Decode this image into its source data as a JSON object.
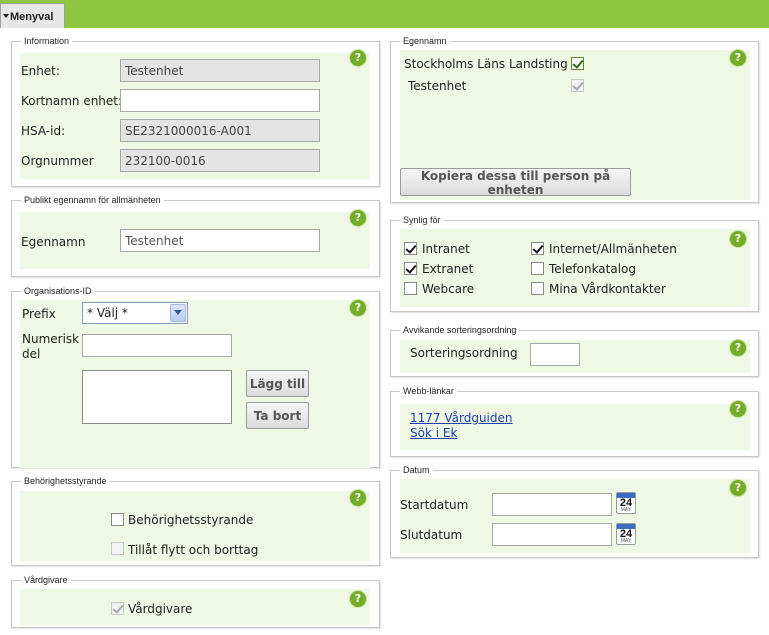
{
  "menu": {
    "label": "Menyval"
  },
  "information": {
    "legend": "Information",
    "enhet_label": "Enhet:",
    "enhet_value": "Testenhet",
    "kortnamn_label": "Kortnamn enhet:",
    "kortnamn_value": "",
    "hsa_label": "HSA-id:",
    "hsa_value": "SE2321000016-A001",
    "orgnummer_label": "Orgnummer",
    "orgnummer_value": "232100-0016"
  },
  "publikt": {
    "legend": "Publikt egennamn för allmänheten",
    "egennamn_label": "Egennamn",
    "egennamn_value": "Testenhet"
  },
  "organisations_id": {
    "legend": "Organisations-ID",
    "prefix_label": "Prefix",
    "prefix_selected": "* Välj *",
    "numerisk_label_1": "Numerisk",
    "numerisk_label_2": "del",
    "numerisk_value": "",
    "add_button": "Lägg till",
    "remove_button": "Ta bort"
  },
  "behorighet": {
    "legend": "Behörighetsstyrande",
    "behorighet_label": "Behörighetsstyrande",
    "behorighet_checked": false,
    "flytt_label": "Tillåt flytt och borttag",
    "flytt_checked": false
  },
  "vardgivare": {
    "legend": "Vårdgivare",
    "vardgivare_label": "Vårdgivare",
    "vardgivare_checked": true
  },
  "egennamn": {
    "legend": "Egennamn",
    "items": [
      {
        "label": "Stockholms Läns Landsting",
        "checked": true
      },
      {
        "label": "Testenhet",
        "checked": true
      }
    ],
    "copy_button": "Kopiera dessa till person på enheten"
  },
  "synlig_for": {
    "legend": "Synlig för",
    "items": [
      {
        "label": "Intranet",
        "checked": true
      },
      {
        "label": "Internet/Allmänheten",
        "checked": true
      },
      {
        "label": "Extranet",
        "checked": true
      },
      {
        "label": "Telefonkatalog",
        "checked": false
      },
      {
        "label": "Webcare",
        "checked": false
      },
      {
        "label": "Mina Vårdkontakter",
        "checked": false
      }
    ]
  },
  "sortering": {
    "legend": "Avvikande sorteringsordning",
    "label": "Sorteringsordning",
    "value": ""
  },
  "webblankar": {
    "legend": "Webb-länkar",
    "links": [
      "1177 Vårdguiden",
      "Sök i Ek"
    ]
  },
  "datum": {
    "legend": "Datum",
    "start_label": "Startdatum",
    "start_value": "",
    "slut_label": "Slutdatum",
    "slut_value": "",
    "calendar_day": "24",
    "calendar_month": "MAY"
  },
  "help": {
    "symbol": "?"
  },
  "colors": {
    "topbar": "#8dc63f",
    "panel": "#eff7e5",
    "help": "#74ad27",
    "link": "#1a3fb0"
  }
}
